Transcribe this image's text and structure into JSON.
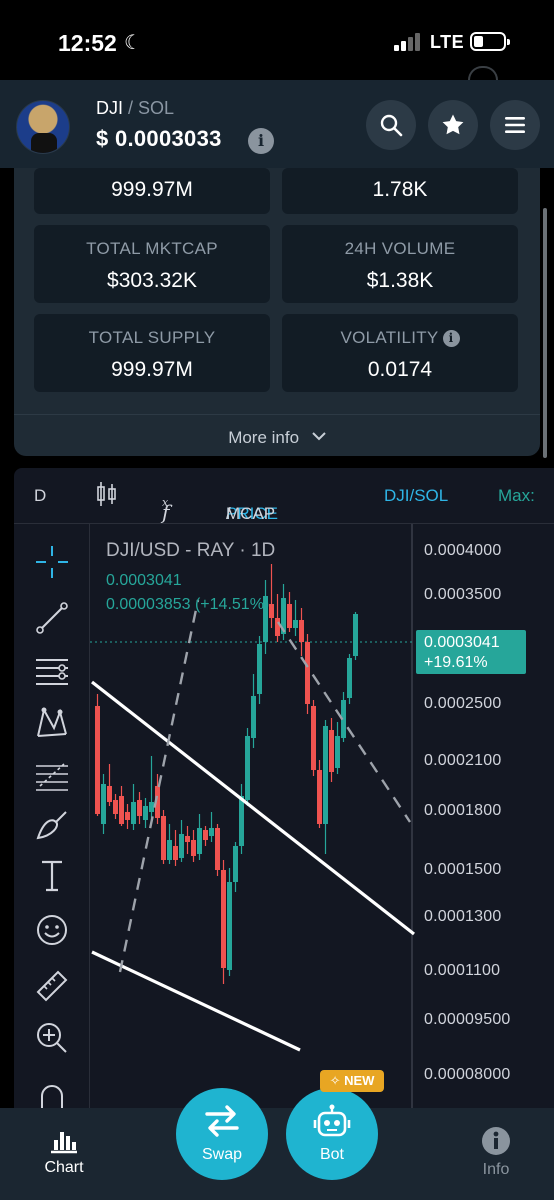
{
  "status_bar": {
    "time": "12:52",
    "network": "LTE"
  },
  "header": {
    "token": "DJI",
    "separator": "/",
    "quote": "SOL",
    "price": "$ 0.0003033",
    "info_glyph": "i"
  },
  "stats": {
    "cut_row": [
      "999.97M",
      "1.78K"
    ],
    "rows": [
      {
        "label": "TOTAL MKTCAP",
        "value": "$303.32K"
      },
      {
        "label": "24H VOLUME",
        "value": "$1.38K"
      },
      {
        "label": "TOTAL SUPPLY",
        "value": "999.97M"
      },
      {
        "label": "VOLATILITY",
        "value": "0.0174"
      }
    ],
    "more_info": "More info"
  },
  "chart_toolbar": {
    "interval": "D",
    "fx": "f",
    "price": "PRICE",
    "slash": "/",
    "mcap": "MCAP",
    "pair": "DJI/SOL",
    "max": "Max:"
  },
  "chart_legend": {
    "title": "DJI/USD - RAY · 1D",
    "line1": "0.0003041",
    "line2": "0.00003853 (+14.51%)"
  },
  "chart_data": {
    "type": "candlestick",
    "title": "DJI/USD - RAY · 1D",
    "y_ticks": [
      "0.0004000",
      "0.0003500",
      "0.0002500",
      "0.0002100",
      "0.0001800",
      "0.0001500",
      "0.0001300",
      "0.0001100",
      "0.00009500",
      "0.00008000"
    ],
    "last_price": {
      "value": "0.0003041",
      "change": "+19.61%"
    },
    "colors": {
      "up": "#26a69a",
      "down": "#ef5350"
    }
  },
  "bottom_nav": {
    "chart": "Chart",
    "swap": "Swap",
    "bot": "Bot",
    "new_badge": "NEW",
    "info": "Info"
  }
}
